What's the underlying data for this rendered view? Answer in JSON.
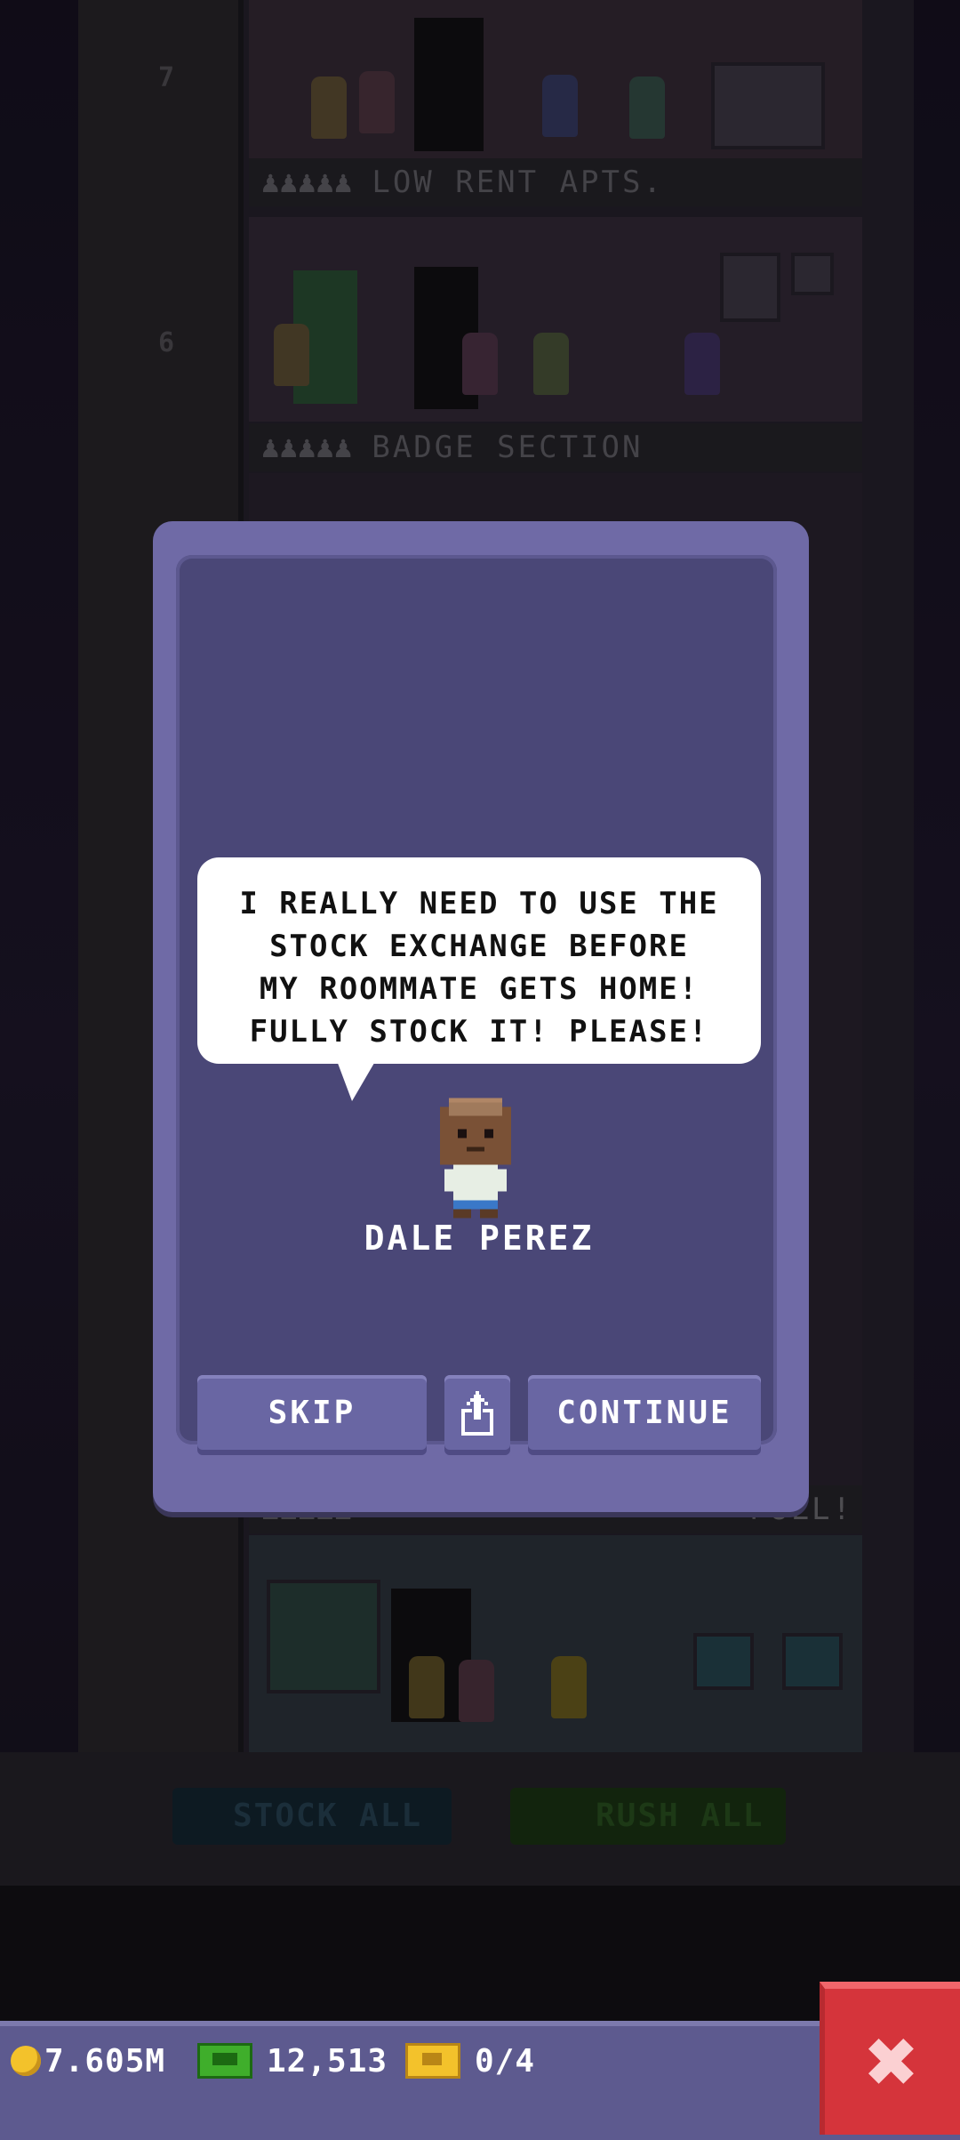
{
  "tower": {
    "floors": [
      {
        "number": "7",
        "name": "LOW RENT APTS.",
        "status": ""
      },
      {
        "number": "6",
        "name": "BADGE SECTION",
        "status": ""
      },
      {
        "number": "",
        "name": "",
        "status": "FULL!"
      }
    ],
    "buttons": {
      "stock_all": "STOCK ALL",
      "rush_all": "RUSH ALL"
    }
  },
  "dialog": {
    "speech": "I REALLY NEED TO USE THE\nSTOCK EXCHANGE BEFORE\nMY ROOMMATE GETS HOME!\nFULLY STOCK IT! PLEASE!",
    "character_name": "DALE PEREZ",
    "buttons": {
      "skip": "SKIP",
      "share_icon": "share-icon",
      "continue": "CONTINUE"
    }
  },
  "status_bar": {
    "coins": "7.605M",
    "bux": "12,513",
    "tickets": "0/4",
    "close_icon": "close-icon"
  },
  "colors": {
    "dialog_frame": "#6f6aa6",
    "dialog_panel": "#4a4777",
    "button": "#6966a3",
    "status_bar": "#5d5a8f",
    "close_button": "#d5343b"
  }
}
